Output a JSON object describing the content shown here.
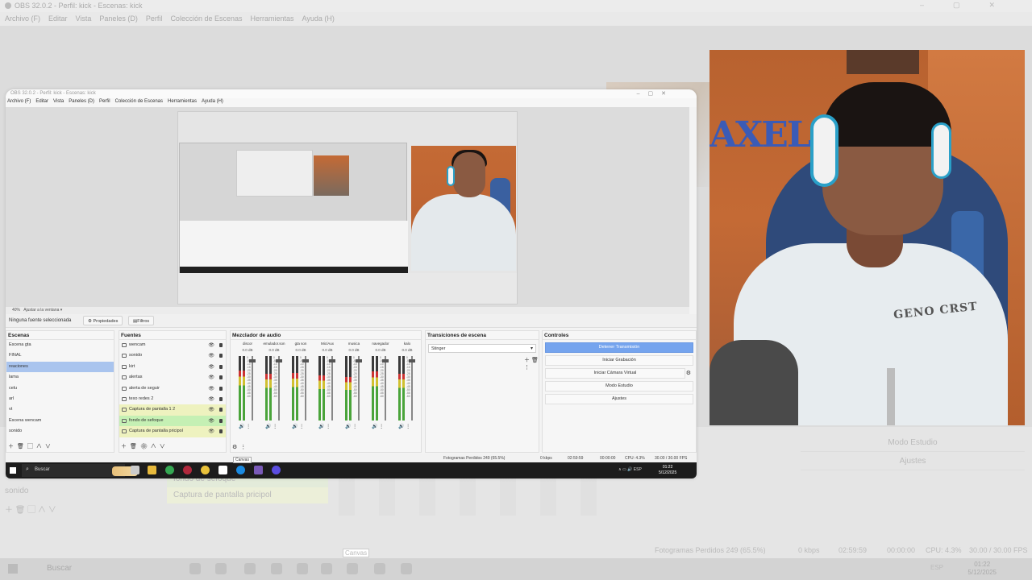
{
  "outer": {
    "title": "OBS 32.0.2 - Perfil: kick - Escenas: kick",
    "menu": [
      "Archivo (F)",
      "Editar",
      "Vista",
      "Paneles (D)",
      "Perfil",
      "Colección de Escenas",
      "Herramientas",
      "Ayuda (H)"
    ],
    "scenes": [
      "Escena wencam",
      "sonido"
    ],
    "sources": [
      "fondo de sefoque",
      "Captura de pantalla pricipol"
    ],
    "controls": [
      "Modo Estudio",
      "Ajustes"
    ],
    "status": {
      "dropped": "Fotogramas Perdidos 249 (65.5%)",
      "kbps": "0 kbps",
      "stream_time": "02:59:59",
      "rec_time": "00:00:00",
      "cpu": "CPU: 4.3%",
      "fps": "30.00 / 30.00 FPS"
    },
    "taskbar": {
      "search": "Buscar",
      "lang": "ESP",
      "time": "01:22",
      "date": "5/12/2025"
    },
    "tooltip": "Canvas"
  },
  "obs": {
    "title": "OBS 32.0.2 - Perfil: kick - Escenas: kick",
    "menu": [
      "Archivo (F)",
      "Editar",
      "Vista",
      "Paneles (D)",
      "Perfil",
      "Colección de Escenas",
      "Herramientas",
      "Ayuda (H)"
    ],
    "zoom": "40%",
    "zoom_fit": "Ajustar a la ventana",
    "no_source": "Ninguna fuente seleccionada",
    "properties_btn": "Propiedades",
    "filters_btn": "Filtros",
    "docks": {
      "scenes_title": "Escenas",
      "sources_title": "Fuentes",
      "mixer_title": "Mezclador de audio",
      "transitions_title": "Transiciones de escena",
      "controls_title": "Controles"
    },
    "scenes": [
      "Escena gta",
      "FINAL",
      "reaciones",
      "lama",
      "celu",
      "arl",
      "vt",
      "Escena wencam",
      "sonido"
    ],
    "selected_scene_index": 2,
    "sources": [
      {
        "name": "wencam",
        "style": "plain"
      },
      {
        "name": "sonido",
        "style": "plain"
      },
      {
        "name": "kirt",
        "style": "plain"
      },
      {
        "name": "alertas",
        "style": "plain"
      },
      {
        "name": "alerta de seguir",
        "style": "plain"
      },
      {
        "name": "texo redes 2",
        "style": "plain"
      },
      {
        "name": "Captura de pantalla 1 2",
        "style": "yellow"
      },
      {
        "name": "fondo de sefoque",
        "style": "green"
      },
      {
        "name": "Captura de pantalla pricipol",
        "style": "yellow"
      }
    ],
    "mixer": [
      {
        "name": "discor",
        "db": "0.0 dB",
        "level": 0.78
      },
      {
        "name": "emulador.son",
        "db": "0.0 dB",
        "level": 0.72
      },
      {
        "name": "gta son",
        "db": "0.0 dB",
        "level": 0.74
      },
      {
        "name": "Mic/Aux",
        "db": "0.0 dB",
        "level": 0.7
      },
      {
        "name": "musica",
        "db": "0.0 dB",
        "level": 0.68
      },
      {
        "name": "navegador",
        "db": "0.0 dB",
        "level": 0.76
      },
      {
        "name": "kalo",
        "db": "0.0 dB",
        "level": 0.73
      }
    ],
    "mixer_scale": [
      "0",
      "-5",
      "-10",
      "-15",
      "-20",
      "-25",
      "-30",
      "-35",
      "-40",
      "-45",
      "-50",
      "-55",
      "-60"
    ],
    "transition": "Stinger",
    "controls": {
      "stop_stream": "Detener Transmisión",
      "start_rec": "Iniciar Grabación",
      "virtual_cam": "Iniciar Cámara Virtual",
      "studio": "Modo Estudio",
      "settings": "Ajustes"
    },
    "status": {
      "dropped": "Fotogramas Perdidos 249 (65.5%)",
      "kbps": "0 kbps",
      "stream_time": "02:59:59",
      "rec_time": "00:00:00",
      "cpu": "CPU: 4.3%",
      "fps": "30.00 / 30.00 FPS"
    },
    "tooltip": "Canvas",
    "taskbar": {
      "search": "Buscar",
      "lang": "ESP",
      "time": "01:22",
      "date": "5/12/2025"
    }
  },
  "webcam": {
    "letters": "AXEL",
    "shirt_logo": "GENO CRST"
  },
  "colors": {
    "accent": "#75a4ee",
    "selected_scene": "#a9c4ee",
    "source_green": "#c5f0b4",
    "source_yellow": "#eef2bf",
    "taskbar": "#1c1c1c"
  }
}
